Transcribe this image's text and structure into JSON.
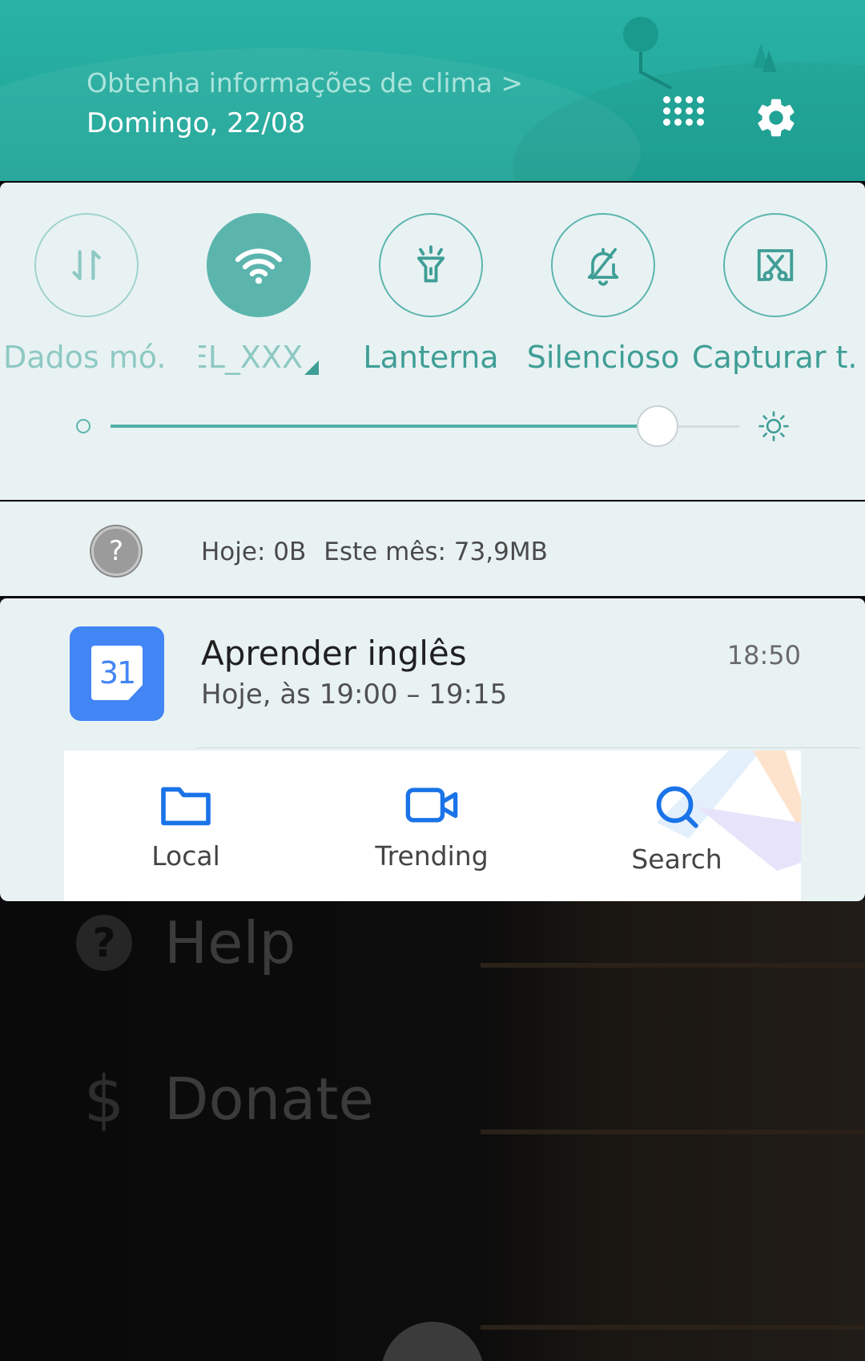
{
  "header": {
    "weather_link": "Obtenha informações de clima >",
    "date": "Domingo, 22/08"
  },
  "quick_settings": {
    "tiles": [
      {
        "label": "Dados mó..",
        "icon": "mobile-data-icon",
        "state": "off"
      },
      {
        "label": "EL_XXX",
        "icon": "wifi-icon",
        "state": "on"
      },
      {
        "label": "Lanterna",
        "icon": "flashlight-icon",
        "state": "off"
      },
      {
        "label": "Silencioso",
        "icon": "bell-off-icon",
        "state": "off"
      },
      {
        "label": "Capturar t..",
        "icon": "screenshot-scissors-icon",
        "state": "off"
      }
    ],
    "brightness_level": 0.87
  },
  "data_usage": {
    "today": "Hoje: 0B",
    "month": "Este mês: 73,9MB"
  },
  "notification": {
    "app_icon_day": "31",
    "title": "Aprender inglês",
    "subtitle": "Hoje, às 19:00 – 19:15",
    "time": "18:50"
  },
  "bottom_nav": {
    "items": [
      {
        "label": "Local",
        "icon": "folder-icon"
      },
      {
        "label": "Trending",
        "icon": "video-camera-icon"
      },
      {
        "label": "Search",
        "icon": "search-icon"
      }
    ]
  },
  "background_menu": {
    "help": "Help",
    "donate": "Donate",
    "donate_symbol": "$",
    "help_symbol": "?"
  },
  "colors": {
    "header_teal": "#22ab9e",
    "accent_teal": "#5bb5ad",
    "link_blue": "#1a73e8",
    "calendar_blue": "#4285f4"
  }
}
